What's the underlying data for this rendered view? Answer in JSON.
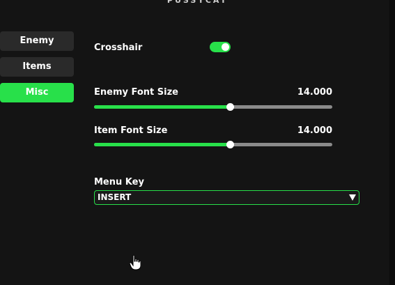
{
  "app": {
    "title": "PUSSYCAT"
  },
  "nav": {
    "items": [
      {
        "label": "Enemy",
        "active": false
      },
      {
        "label": "Items",
        "active": false
      },
      {
        "label": "Misc",
        "active": true
      }
    ]
  },
  "misc": {
    "crosshair": {
      "label": "Crosshair",
      "enabled": true
    },
    "enemy_font_size": {
      "label": "Enemy Font Size",
      "value_text": "14.000",
      "fill_fraction": 0.57
    },
    "item_font_size": {
      "label": "Item Font Size",
      "value_text": "14.000",
      "fill_fraction": 0.57
    },
    "menu_key": {
      "label": "Menu Key",
      "value": "INSERT"
    }
  },
  "colors": {
    "accent": "#28e04a",
    "background": "#141414",
    "button": "#2a2a2a",
    "track": "#8a8a8a"
  },
  "icons": {
    "dropdown": "triangle-down-icon",
    "cursor": "hand-pointer-icon"
  }
}
